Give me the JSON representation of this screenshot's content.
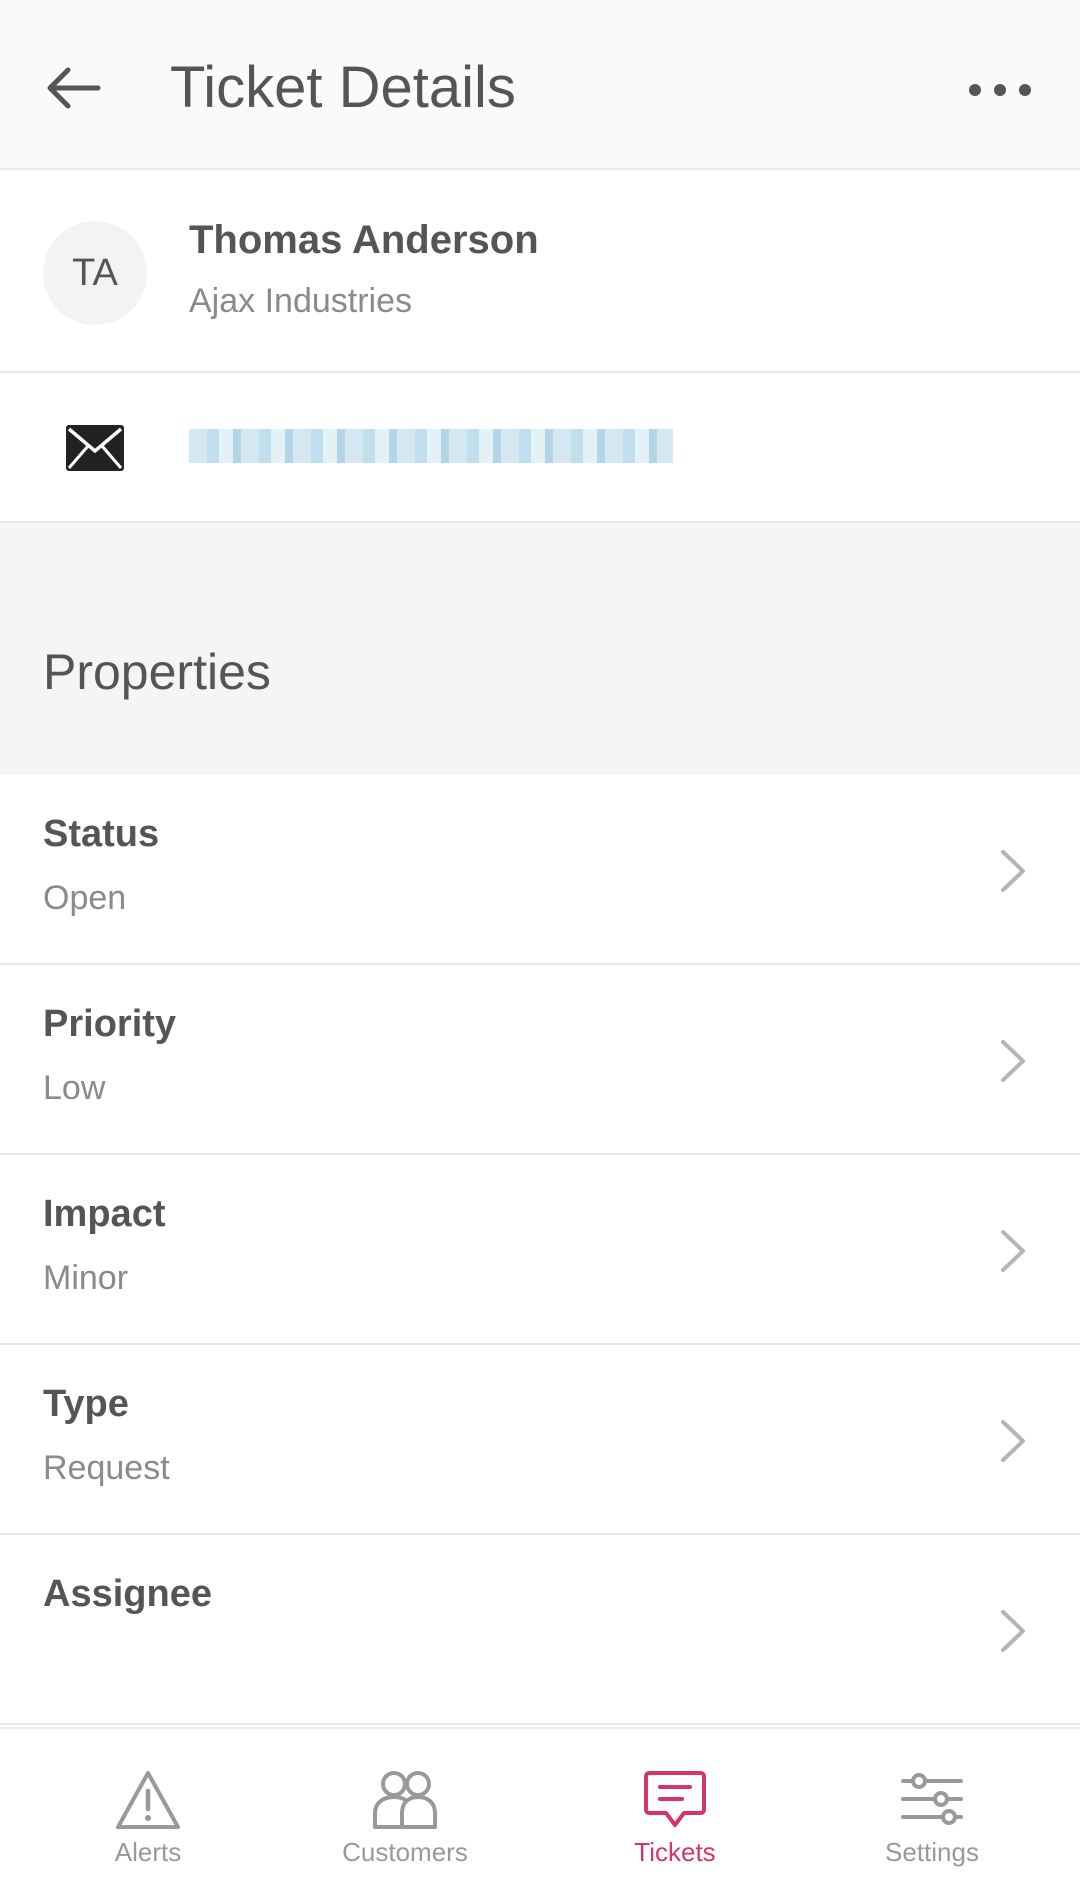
{
  "header": {
    "title": "Ticket Details",
    "back_icon": "arrow-left-icon",
    "more_icon": "more-horizontal-icon"
  },
  "customer": {
    "initials": "TA",
    "name": "Thomas Anderson",
    "company": "Ajax Industries",
    "email_icon": "mail-icon"
  },
  "properties": {
    "section_title": "Properties",
    "items": [
      {
        "label": "Status",
        "value": "Open"
      },
      {
        "label": "Priority",
        "value": "Low"
      },
      {
        "label": "Impact",
        "value": "Minor"
      },
      {
        "label": "Type",
        "value": "Request"
      },
      {
        "label": "Assignee",
        "value": ""
      }
    ]
  },
  "nav": {
    "items": [
      {
        "label": "Alerts",
        "icon": "alert-triangle-icon",
        "active": false
      },
      {
        "label": "Customers",
        "icon": "users-icon",
        "active": false
      },
      {
        "label": "Tickets",
        "icon": "message-square-icon",
        "active": true
      },
      {
        "label": "Settings",
        "icon": "sliders-icon",
        "active": false
      }
    ]
  },
  "colors": {
    "accent": "#d6336c",
    "text": "#555555",
    "muted": "#8a8a8a",
    "section_bg": "#f5f5f5"
  }
}
